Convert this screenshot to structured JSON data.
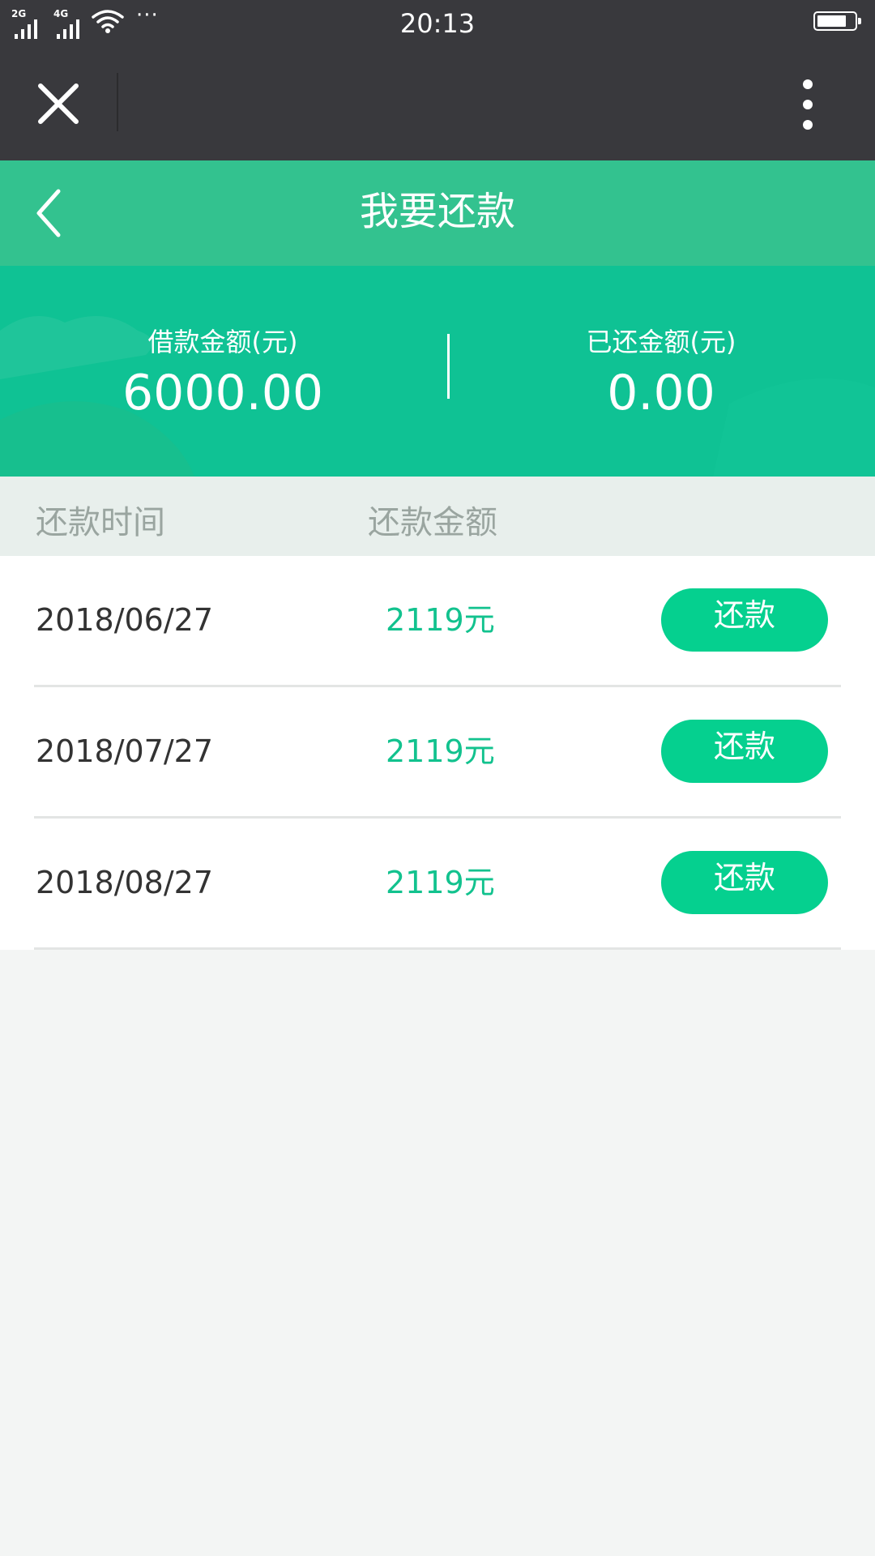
{
  "status_bar": {
    "network1": "2G",
    "network2": "4G",
    "more": "···",
    "time": "20:13",
    "battery_level": 0.8
  },
  "top_bar": {
    "close_icon": "close-icon",
    "menu_icon": "more-vertical-icon"
  },
  "header": {
    "back_icon": "chevron-left-icon",
    "title": "我要还款"
  },
  "summary": {
    "loan_label": "借款金额(元)",
    "loan_value": "6000.00",
    "repaid_label": "已还金额(元)",
    "repaid_value": "0.00"
  },
  "table": {
    "headers": [
      "还款时间",
      "还款金额"
    ],
    "rows": [
      {
        "date": "2018/06/27",
        "amount": "2119元",
        "button": "还款"
      },
      {
        "date": "2018/07/27",
        "amount": "2119元",
        "button": "还款"
      },
      {
        "date": "2018/08/27",
        "amount": "2119元",
        "button": "还款"
      }
    ]
  },
  "colors": {
    "status_bg": "#39393d",
    "header_bg": "#33c28f",
    "banner_bg": "#0fc294",
    "accent": "#05d08f",
    "page_bg": "#f3f5f4"
  }
}
